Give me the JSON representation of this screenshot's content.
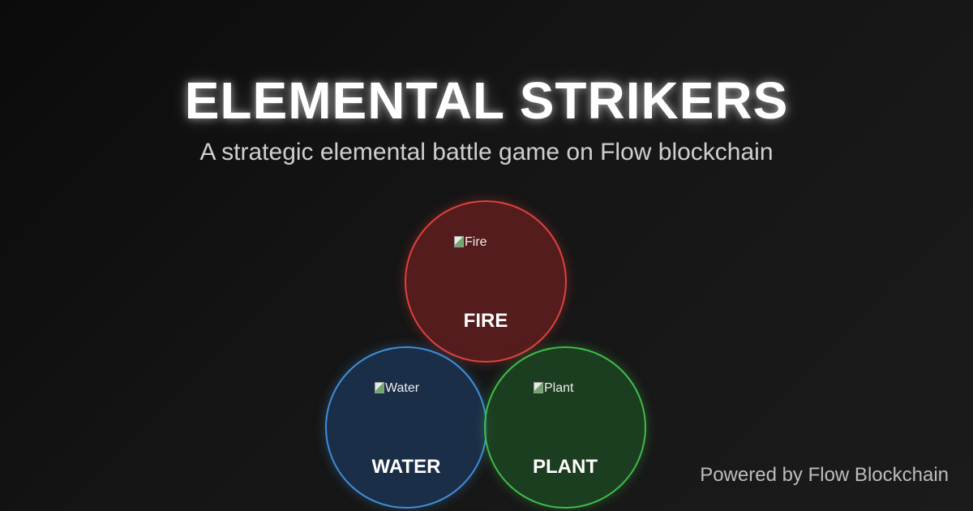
{
  "title": "ELEMENTAL STRIKERS",
  "subtitle": "A strategic elemental battle game on Flow blockchain",
  "elements": [
    {
      "name": "FIRE",
      "image_alt": "Fire",
      "color": "#e0413f"
    },
    {
      "name": "WATER",
      "image_alt": "Water",
      "color": "#3f8fd8"
    },
    {
      "name": "PLANT",
      "image_alt": "Plant",
      "color": "#3fbd4a"
    }
  ],
  "footer": {
    "powered_by": "Powered by Flow Blockchain"
  }
}
